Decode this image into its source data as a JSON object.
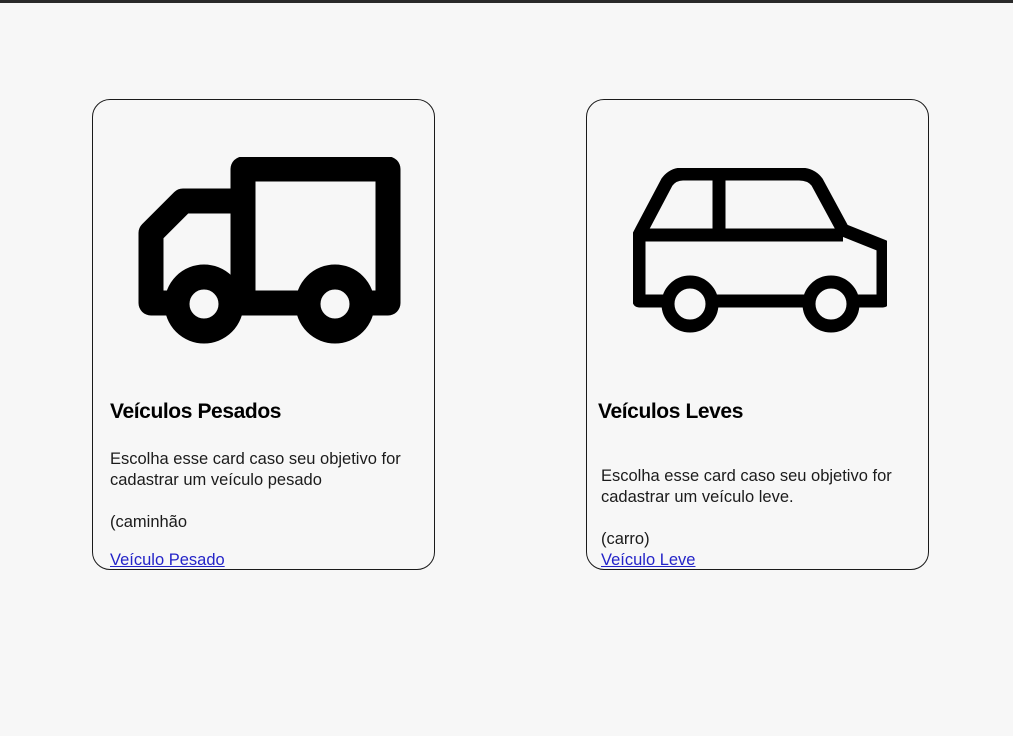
{
  "cards": {
    "heavy": {
      "icon": "truck-icon",
      "title": "Veículos Pesados",
      "description": "Escolha esse card caso seu objetivo for cadastrar um veículo pesado",
      "note": "(caminhão",
      "link_label": "Veículo Pesado"
    },
    "light": {
      "icon": "car-icon",
      "title": "Veículos Leves",
      "description": "Escolha esse card caso seu objetivo for cadastrar um veículo leve.",
      "note": "(carro)",
      "link_label": "Veículo Leve"
    }
  },
  "colors": {
    "background": "#f7f7f7",
    "border": "#1a1a1a",
    "link": "#2424c8",
    "icon": "#000000"
  }
}
